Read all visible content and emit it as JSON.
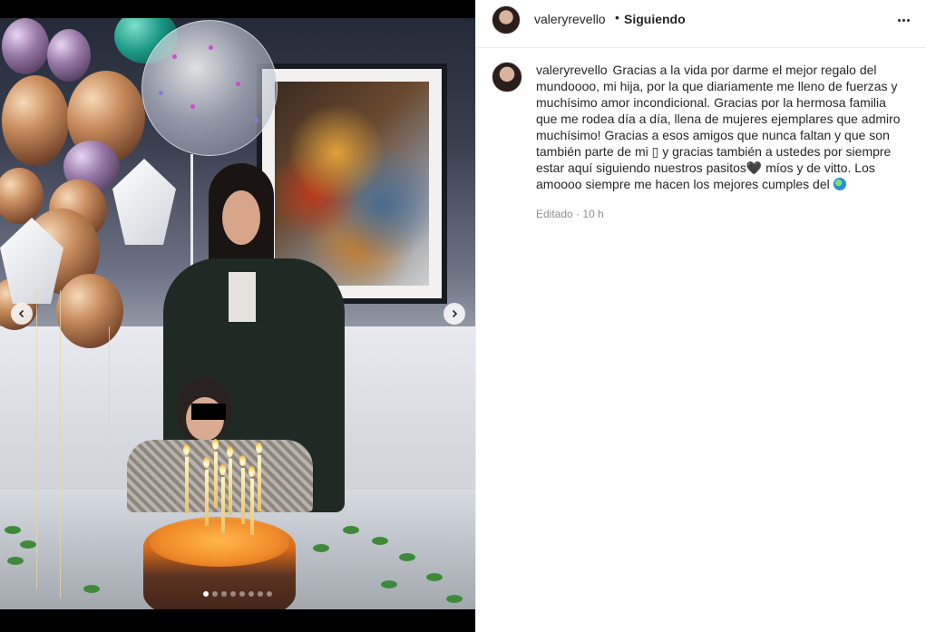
{
  "post": {
    "username": "valeryrevello",
    "separator": "•",
    "follow_status": "Siguiendo",
    "caption_user": "valeryrevello",
    "caption_text": "Gracias a la vida por darme el mejor regalo del mundoooo, mi hija, por la que diariamente me lleno de fuerzas y muchísimo amor incondicional. Gracias por la hermosa familia que me rodea día a día, llena de mujeres ejemplares que admiro muchísimo! Gracias a esos amigos que nunca faltan y que son también parte de mi ▯ y gracias también a ustedes por siempre estar aquí siguiendo nuestros pasitos🖤 míos y de vitto. Los amoooo siempre me hacen los mejores cumples del",
    "meta": "Editado · 10 h"
  },
  "carousel": {
    "total_slides": 8,
    "active_index": 0
  },
  "icons": {
    "more": "more-options-icon",
    "prev": "chevron-left-icon",
    "next": "chevron-right-icon",
    "emoji_end": "globe-emoji-icon"
  },
  "colors": {
    "text": "#262626",
    "muted": "#8e8e8e",
    "border": "#efefef"
  }
}
